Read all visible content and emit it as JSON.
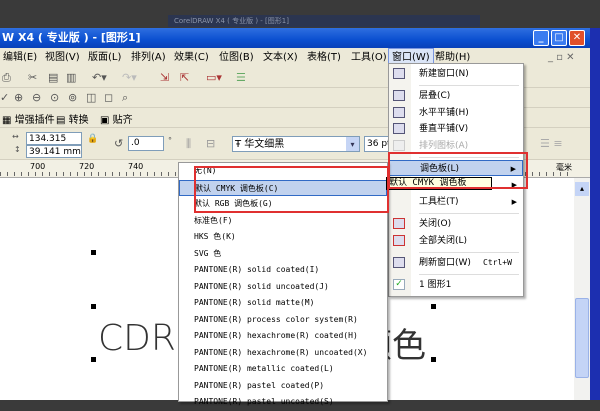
{
  "background_window_title": "CorelDRAW X4 ( 专业版 ) - [图形1]",
  "title": "W X4 ( 专业版 ) - [图形1]",
  "menubar": [
    "编辑(E)",
    "视图(V)",
    "版面(L)",
    "排列(A)",
    "效果(C)",
    "位图(B)",
    "文本(X)",
    "表格(T)",
    "工具(O)",
    "窗口(W)",
    "帮助(H)"
  ],
  "toolbar3": {
    "plugin": "增强插件",
    "convert": "转换",
    "snap": "贴齐"
  },
  "propbar": {
    "width": "134.315 mm",
    "height": "39.141 mm",
    "rotation": ".0",
    "degree": "°",
    "font": "华文细黑",
    "size": "36 pt"
  },
  "ruler": {
    "labels": [
      "700",
      "720",
      "740"
    ],
    "unit": "毫米"
  },
  "canvas": {
    "text_left": "CDR",
    "text_right": "颜色"
  },
  "window_menu": {
    "items": [
      {
        "label": "新建窗口(N)"
      },
      {
        "label": "层叠(C)"
      },
      {
        "label": "水平平铺(H)"
      },
      {
        "label": "垂直平铺(V)"
      },
      {
        "label": "排列图标(A)",
        "disabled": true
      },
      {
        "label": "调色板(L)",
        "highlighted": true
      },
      {
        "label": "默认 CMYK 调色板"
      },
      {
        "label": "工具栏(T)"
      },
      {
        "label": "关闭(O)"
      },
      {
        "label": "全部关闭(L)"
      },
      {
        "label": "刷新窗口(W)",
        "shortcut": "Ctrl+W"
      },
      {
        "label": "1 图形1",
        "checked": true
      }
    ]
  },
  "palette_submenu": {
    "items": [
      "无(N)",
      "默认 CMYK 调色板(C)",
      "默认 RGB 调色板(G)",
      "标准色(F)",
      "HKS 色(K)",
      "SVG 色",
      "PANTONE(R) solid coated(I)",
      "PANTONE(R) solid uncoated(J)",
      "PANTONE(R) solid matte(M)",
      "PANTONE(R) process color system(R)",
      "PANTONE(R) hexachrome(R) coated(H)",
      "PANTONE(R) hexachrome(R) uncoated(X)",
      "PANTONE(R) metallic coated(L)",
      "PANTONE(R) pastel coated(P)",
      "PANTONE(R) pastel uncoated(S)"
    ],
    "highlighted_index": 1
  },
  "colors": {
    "highlight": "#c1d2ee",
    "annotation": "#e03030",
    "titlebar": "#0a4fd0"
  }
}
